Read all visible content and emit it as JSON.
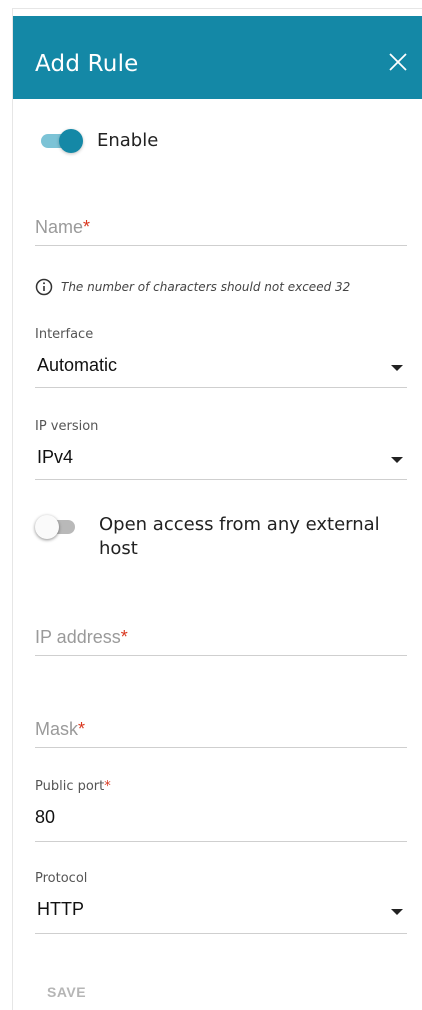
{
  "header": {
    "title": "Add Rule"
  },
  "enable": {
    "label": "Enable",
    "state": "on"
  },
  "name_field": {
    "placeholder": "Name",
    "required_mark": "*",
    "value": ""
  },
  "hint": {
    "text": "The number of characters should not exceed 32"
  },
  "interface": {
    "label": "Interface",
    "value": "Automatic"
  },
  "ip_version": {
    "label": "IP version",
    "value": "IPv4"
  },
  "open_access": {
    "label_line1": "Open access from any external",
    "label_line2": "host",
    "state": "off"
  },
  "ip_address": {
    "placeholder": "IP address",
    "required_mark": "*",
    "value": ""
  },
  "mask": {
    "placeholder": "Mask",
    "required_mark": "*",
    "value": ""
  },
  "public_port": {
    "label": "Public port",
    "required_mark": "*",
    "value": "80"
  },
  "protocol": {
    "label": "Protocol",
    "value": "HTTP"
  },
  "footer": {
    "save_label": "SAVE"
  },
  "colors": {
    "accent": "#1488a6",
    "required": "#d9361e"
  },
  "icons": {
    "close": "close-icon",
    "info": "info-icon",
    "dropdown": "chevron-down-icon"
  }
}
